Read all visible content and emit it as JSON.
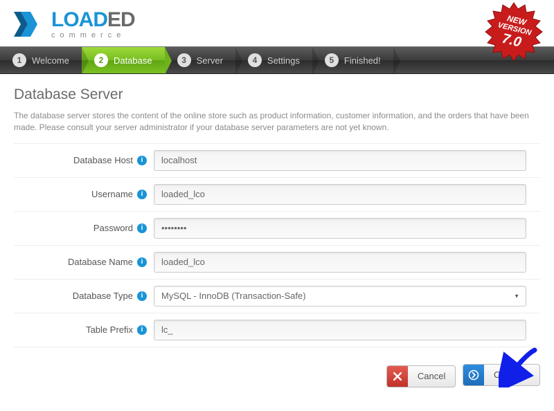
{
  "logo": {
    "word1": "LOAD",
    "word2": "ED",
    "subtitle": "commerce"
  },
  "badge": {
    "line1": "NEW",
    "line2": "VERSION",
    "line3": "7.0"
  },
  "steps": [
    {
      "num": "1",
      "label": "Welcome"
    },
    {
      "num": "2",
      "label": "Database"
    },
    {
      "num": "3",
      "label": "Server"
    },
    {
      "num": "4",
      "label": "Settings"
    },
    {
      "num": "5",
      "label": "Finished!"
    }
  ],
  "page": {
    "title": "Database Server",
    "description": "The database server stores the content of the online store such as product information, customer information, and the orders that have been made. Please consult your server administrator if your database server parameters are not yet known."
  },
  "form": {
    "host_label": "Database Host",
    "host_value": "localhost",
    "user_label": "Username",
    "user_value": "loaded_lco",
    "pass_label": "Password",
    "pass_value": "••••••••",
    "name_label": "Database Name",
    "name_value": "loaded_lco",
    "type_label": "Database Type",
    "type_value": "MySQL - InnoDB (Transaction-Safe)",
    "prefix_label": "Table Prefix",
    "prefix_value": "lc_"
  },
  "buttons": {
    "cancel": "Cancel",
    "continue": "Continue"
  }
}
